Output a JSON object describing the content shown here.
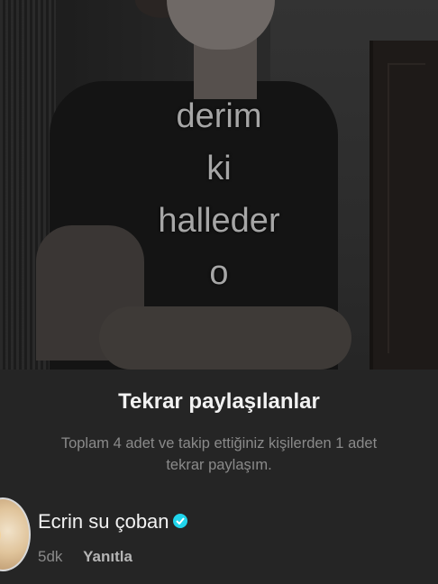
{
  "video": {
    "overlay_lines": [
      "derim",
      "ki",
      "halleder",
      "o"
    ]
  },
  "sheet": {
    "title": "Tekrar paylaşılanlar",
    "subtitle_line1": "Toplam 4 adet ve takip ettiğiniz kişilerden 1 adet",
    "subtitle_line2": "tekrar paylaşım."
  },
  "comment": {
    "username": "Ecrin su çoban",
    "verified": true,
    "time": "5dk",
    "reply_label": "Yanıtla",
    "verified_color": "#20D5EC"
  }
}
